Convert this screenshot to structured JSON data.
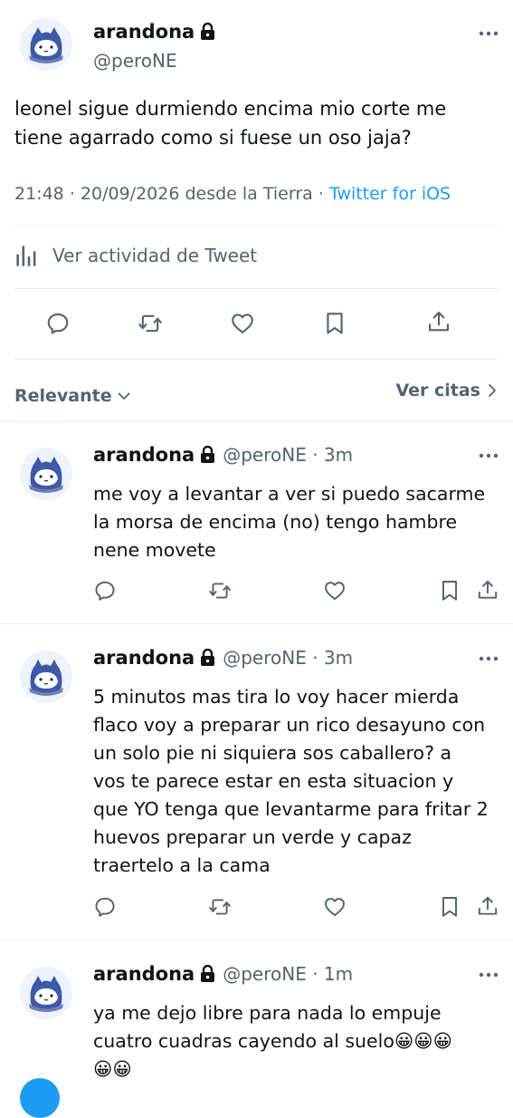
{
  "main_tweet": {
    "display_name": "arandona",
    "handle": "@peroNE",
    "text_line1": "leonel sigue durmiendo encima mio corte me",
    "text_line2": "tiene agarrado como si fuese un oso jaja?",
    "time": "21:48",
    "date": "20/09/2026",
    "location": "desde la Tierra",
    "separator": "·",
    "source": "Twitter for iOS",
    "activity_label": "Ver actividad de Tweet"
  },
  "sort": {
    "label": "Relevante",
    "quotes_label": "Ver citas"
  },
  "replies": [
    {
      "display_name": "arandona",
      "handle": "@peroNE · 3m",
      "lines": [
        "me voy a levantar a ver si puedo sacarme",
        "la morsa de encima (no) tengo hambre",
        "nene movete"
      ]
    },
    {
      "display_name": "arandona",
      "handle": "@peroNE · 3m",
      "lines": [
        "5 minutos mas tira lo voy hacer mierda",
        "flaco voy a preparar un rico desayuno con",
        "un solo pie ni siquiera sos caballero? a",
        "vos te parece estar en esta situacion y",
        "que YO tenga que levantarme para fritar 2",
        "huevos preparar un verde y capaz",
        "traertelo a la cama"
      ]
    },
    {
      "display_name": "arandona",
      "handle": "@peroNE · 1m",
      "lines": [
        "ya me dejo libre para nada lo empuje",
        "cuatro cuadras cayendo al suelo😀😀😀",
        "😀😀"
      ]
    }
  ],
  "icons": {
    "avatar": "cat-avatar-icon",
    "lock": "lock-icon",
    "more": "more-icon",
    "reply": "reply-icon",
    "retweet": "retweet-icon",
    "like": "heart-icon",
    "bookmark": "bookmark-icon",
    "share": "share-icon",
    "activity": "bar-chart-icon",
    "chevron": "chevron-down-icon"
  },
  "colors": {
    "accent": "#1d9bf0",
    "secondary_text": "#536471",
    "divider": "#e6ecf0"
  }
}
